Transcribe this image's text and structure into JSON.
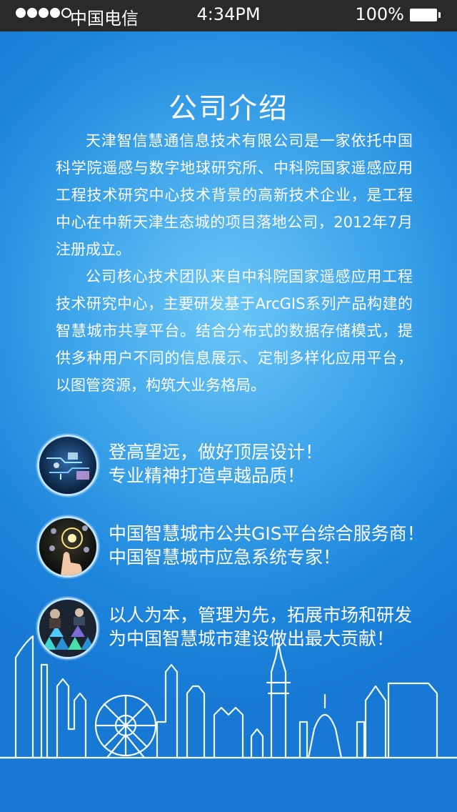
{
  "status_bar": {
    "carrier": "中国电信",
    "time": "4:34PM",
    "battery_percent": "100%"
  },
  "page": {
    "title": "公司介绍",
    "paragraphs": [
      "天津智信慧通信息技术有限公司是一家依托中国科学院遥感与数字地球研究所、中科院国家遥感应用工程技术研究中心技术背景的高新技术企业，是工程中心在中新天津生态城的项目落地公司，2012年7月注册成立。",
      "公司核心技术团队来自中科院国家遥感应用工程技术研究中心，主要研发基于ArcGIS系列产品构建的智慧城市共享平台。结合分布式的数据存储模式，提供多种用户不同的信息展示、定制多样化应用平台，以图管资源，构筑大业务格局。"
    ],
    "features": [
      {
        "line1": "登高望远，做好顶层设计！",
        "line2": "专业精神打造卓越品质！"
      },
      {
        "line1": "中国智慧城市公共GIS平台综合服务商！",
        "line2": "中国智慧城市应急系统专家！"
      },
      {
        "line1": "以人为本，管理为先，拓展市场和研发",
        "line2": "为中国智慧城市建设做出最大贡献！"
      }
    ]
  }
}
